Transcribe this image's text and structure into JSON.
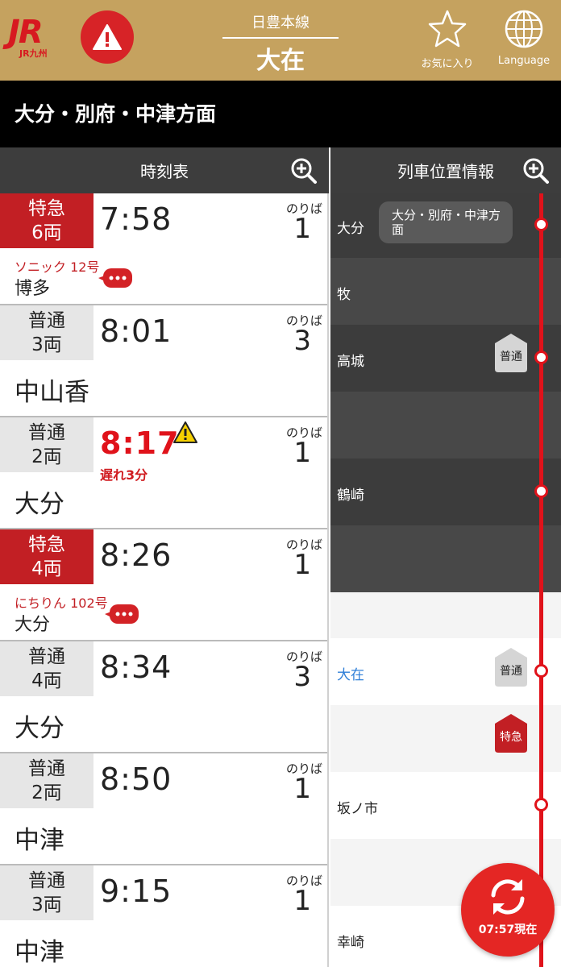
{
  "header": {
    "logo_text": "JR",
    "logo_sub": "JR九州",
    "line_name": "日豊本線",
    "station_name": "大在",
    "favorite_label": "お気に入り",
    "language_label": "Language"
  },
  "direction_title": "大分・別府・中津方面",
  "columns": {
    "timetable": "時刻表",
    "positions": "列車位置情報"
  },
  "platform_label": "のりば",
  "departures": [
    {
      "type": "特急",
      "cars": "6両",
      "time": "7:58",
      "platform": "1",
      "train_name": "ソニック 12号",
      "destination": "博多"
    },
    {
      "type": "普通",
      "cars": "3両",
      "time": "8:01",
      "platform": "3",
      "destination": "中山香"
    },
    {
      "type": "普通",
      "cars": "2両",
      "time": "8:17",
      "platform": "1",
      "delay": "遅れ3分",
      "destination": "大分"
    },
    {
      "type": "特急",
      "cars": "4両",
      "time": "8:26",
      "platform": "1",
      "train_name": "にちりん 102号",
      "destination": "大分"
    },
    {
      "type": "普通",
      "cars": "4両",
      "time": "8:34",
      "platform": "3",
      "destination": "大分"
    },
    {
      "type": "普通",
      "cars": "2両",
      "time": "8:50",
      "platform": "1",
      "destination": "中津"
    },
    {
      "type": "普通",
      "cars": "3両",
      "time": "9:15",
      "platform": "1",
      "destination": "中津"
    }
  ],
  "positions": {
    "direction_bubble": "大分・別府・中津方面",
    "stations": [
      "大分",
      "牧",
      "高城",
      "鶴崎",
      "大在",
      "坂ノ市",
      "幸崎"
    ],
    "marker_local": "普通",
    "marker_express": "特急"
  },
  "refresh": {
    "time_label": "07:57現在"
  },
  "colors": {
    "header_gold": "#c5a25f",
    "jr_red": "#d71920",
    "express_red": "#c21f24",
    "delay_red": "#e0121a",
    "current_station_blue": "#2f7fd8"
  }
}
